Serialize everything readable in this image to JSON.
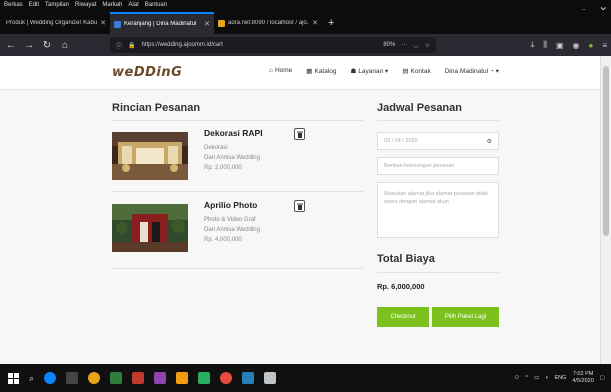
{
  "browser": {
    "menu": [
      "Berkas",
      "Edit",
      "Tampilan",
      "Riwayat",
      "Markah",
      "Alat",
      "Bantuan"
    ],
    "tabs": [
      {
        "label": "Produk | Wedding Organizer Kabu...",
        "active": false
      },
      {
        "label": "Keranjang | Dina Madinatul",
        "active": true
      },
      {
        "label": "aora.net:8090 / localhost / ajo...",
        "active": false
      }
    ],
    "url": "https://wedding.ajoomm.id/cart",
    "zoom": "80%"
  },
  "site": {
    "logo": "weDDinG",
    "nav": [
      {
        "icon": "home-icon",
        "glyph": "⌂",
        "label": "Home"
      },
      {
        "icon": "catalog-icon",
        "glyph": "▦",
        "label": "Katalog"
      },
      {
        "icon": "users-icon",
        "glyph": "👥",
        "label": "Layanan ▾"
      },
      {
        "icon": "contact-icon",
        "glyph": "▤",
        "label": "Kontak"
      },
      {
        "icon": "user-icon",
        "glyph": "",
        "label": "Dina Madinatul ◔ ▾"
      }
    ]
  },
  "order": {
    "title": "Rincian Pesanan",
    "items": [
      {
        "name": "Dekorasi RAPI",
        "category": "Dekorasi",
        "vendor": "Dari Annisa Wedding",
        "price": "Rp. 2,000,000"
      },
      {
        "name": "Aprilio Photo",
        "category": "Photo & Video Graf",
        "vendor": "Dari Annisa Wedding",
        "price": "Rp. 4,000,000"
      }
    ]
  },
  "schedule": {
    "title": "Jadwal Pesanan",
    "date_placeholder": "03 / 04 / 2020",
    "note_placeholder": "Berikan keterangan pesanan",
    "address_placeholder": "Masukan alamat jika alamat pesanan tidak sama dengan alamat akun"
  },
  "total": {
    "title": "Total Biaya",
    "value": "Rp. 6,000,000",
    "checkout_label": "Checkout",
    "more_label": "Pilih Paket Lagi"
  },
  "taskbar": {
    "lang": "ENG",
    "time": "7:02 PM",
    "date": "4/5/2020"
  },
  "colors": {
    "accent_green": "#7cc21f",
    "logo_brown": "#6b4a2a",
    "firefox_blue": "#0a84ff"
  }
}
